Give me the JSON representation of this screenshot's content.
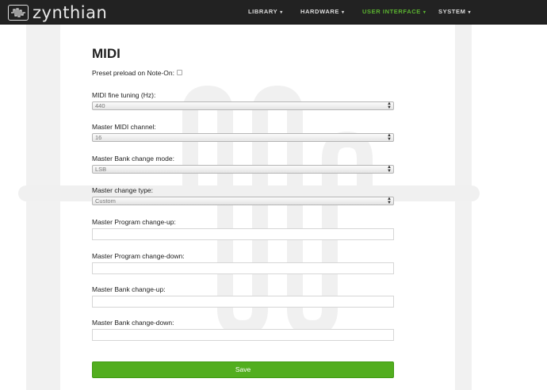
{
  "brand": {
    "name": "zynthian"
  },
  "nav": {
    "items": [
      {
        "label": "LIBRARY",
        "active": false
      },
      {
        "label": "HARDWARE",
        "active": false
      },
      {
        "label": "USER INTERFACE",
        "active": true
      },
      {
        "label": "SYSTEM",
        "active": false
      }
    ],
    "active_color": "#5cb531"
  },
  "page": {
    "title": "MIDI"
  },
  "form": {
    "preset_preload": {
      "label": "Preset preload on Note-On:",
      "checked": false
    },
    "fine_tuning": {
      "label": "MIDI fine tuning (Hz):",
      "value": "440"
    },
    "master_channel": {
      "label": "Master MIDI channel:",
      "value": "16"
    },
    "bank_change_mode": {
      "label": "Master Bank change mode:",
      "value": "LSB"
    },
    "change_type": {
      "label": "Master change type:",
      "value": "Custom"
    },
    "program_change_up": {
      "label": "Master Program change-up:",
      "value": ""
    },
    "program_change_down": {
      "label": "Master Program change-down:",
      "value": ""
    },
    "bank_change_up": {
      "label": "Master Bank change-up:",
      "value": ""
    },
    "bank_change_down": {
      "label": "Master Bank change-down:",
      "value": ""
    },
    "save_label": "Save"
  },
  "colors": {
    "navbar": "#222222",
    "save_button": "#52ae1f",
    "accent": "#5cb531"
  },
  "icons": {
    "logo": "waveform-logo-icon",
    "dropdown": "select-arrows-icon"
  }
}
